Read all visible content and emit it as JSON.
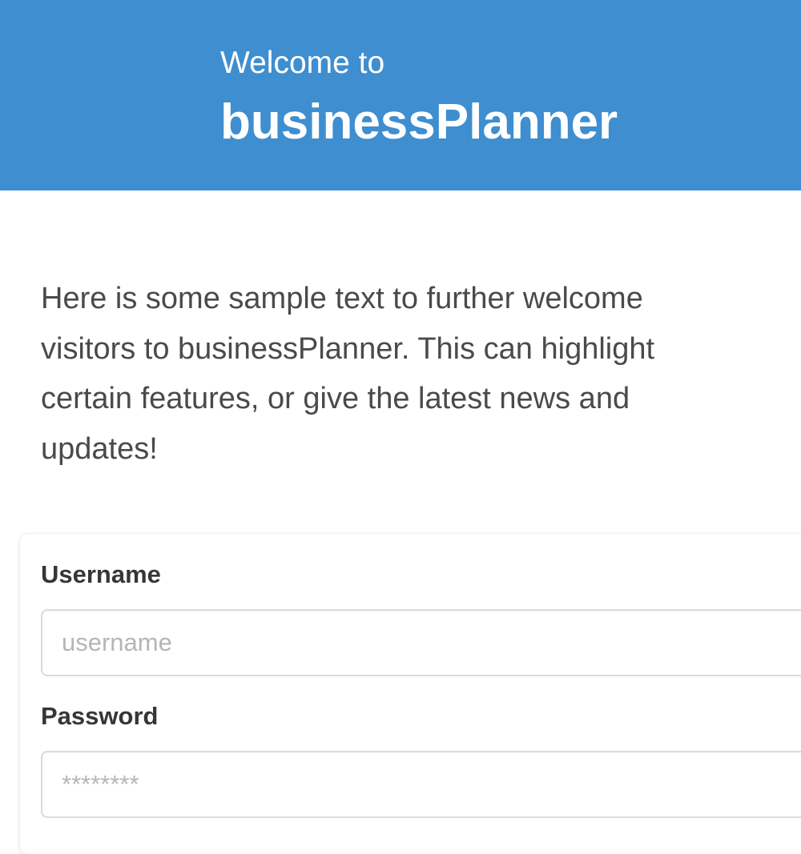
{
  "hero": {
    "subtitle": "Welcome to",
    "title": "businessPlanner"
  },
  "intro": {
    "text": "Here is some sample text to further welcome visitors to businessPlanner. This can highlight certain features, or give the latest news and updates!"
  },
  "login_form": {
    "username_label": "Username",
    "username_placeholder": "username",
    "password_label": "Password",
    "password_placeholder": "********"
  },
  "colors": {
    "hero_background": "#3e8ed0",
    "hero_text": "#ffffff",
    "body_text": "#4a4a4a",
    "label_text": "#363636",
    "input_border": "#dbdbdb",
    "placeholder_text": "#b5b5b5"
  }
}
